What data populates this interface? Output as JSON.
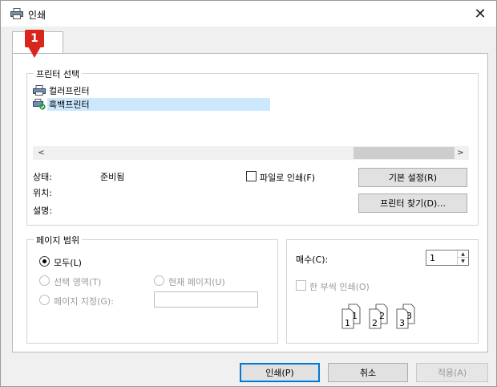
{
  "window": {
    "title": "인쇄",
    "close_glyph": "✕"
  },
  "badge": {
    "number": "1",
    "color": "#d9261c"
  },
  "printer_group": {
    "legend": "프린터 선택",
    "printers": [
      {
        "name": "컬러프린터",
        "icon": "printer-icon",
        "selected": false
      },
      {
        "name": "흑백프린터",
        "icon": "default-printer-icon",
        "selected": true
      }
    ],
    "scroll_left": "<",
    "scroll_right": ">",
    "status_label": "상태:",
    "status_value": "준비됨",
    "location_label": "위치:",
    "comment_label": "설명:",
    "print_to_file_label": "파일로 인쇄(F)",
    "preferences_button": "기본 설정(R)",
    "find_printer_button": "프린터 찾기(D)..."
  },
  "page_range_group": {
    "legend": "페이지 범위",
    "all_label": "모두(L)",
    "selection_label": "선택 영역(T)",
    "current_page_label": "현재 페이지(U)",
    "pages_label": "페이지 지정(G):",
    "pages_value": ""
  },
  "copies_group": {
    "copies_label": "매수(C):",
    "copies_value": "1",
    "collate_label": "한 부씩 인쇄(O)",
    "collate_pages": [
      "1",
      "1",
      "2",
      "2",
      "3",
      "3"
    ]
  },
  "footer": {
    "print_button": "인쇄(P)",
    "cancel_button": "취소",
    "apply_button": "적용(A)"
  },
  "colors": {
    "accent": "#0078d7",
    "selection": "#cce8ff"
  }
}
